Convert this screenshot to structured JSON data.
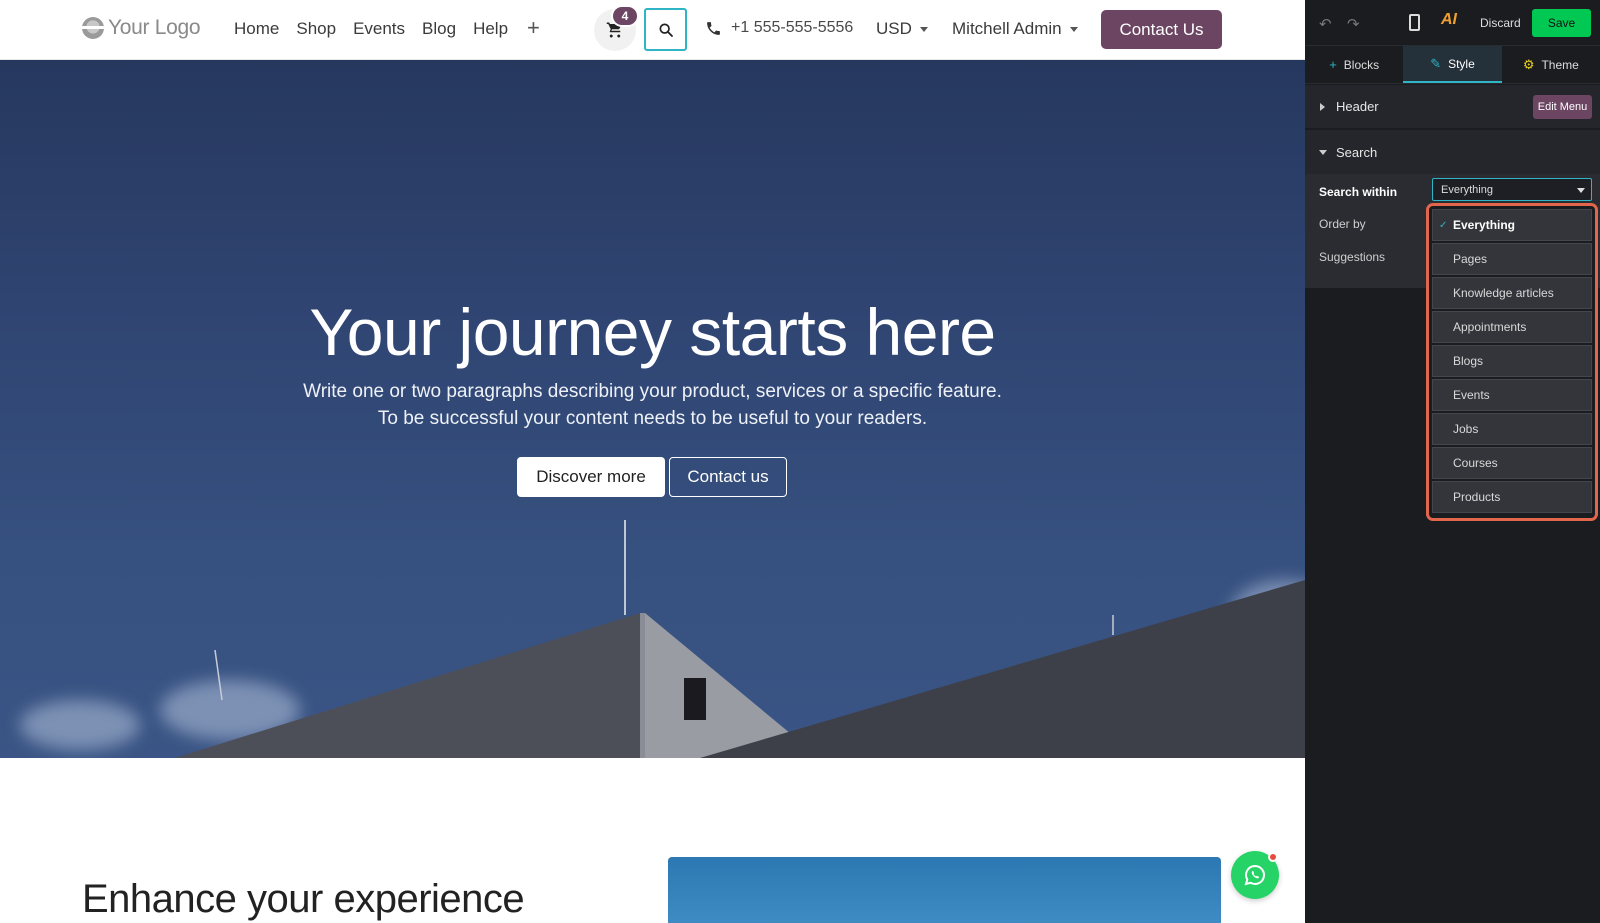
{
  "site": {
    "logo_text": "Your Logo",
    "menu": [
      "Home",
      "Shop",
      "Events",
      "Blog",
      "Help"
    ],
    "add_menu_symbol": "+",
    "cart_count": "4",
    "phone": "+1 555-555-5556",
    "currency": "USD",
    "user": "Mitchell Admin",
    "contact_button": "Contact Us"
  },
  "hero": {
    "title": "Your journey starts here",
    "paragraph_line1": "Write one or two paragraphs describing your product, services or a specific feature.",
    "paragraph_line2": "To be successful your content needs to be useful to your readers.",
    "primary_button": "Discover more",
    "secondary_button": "Contact us"
  },
  "section2": {
    "title": "Enhance your experience"
  },
  "editor": {
    "discard_label": "Discard",
    "save_label": "Save",
    "tabs": [
      {
        "label": "Blocks",
        "icon": "plus-icon"
      },
      {
        "label": "Style",
        "icon": "pencil-icon",
        "active": true
      },
      {
        "label": "Theme",
        "icon": "gear-icon"
      }
    ],
    "sections": {
      "header_title": "Header",
      "edit_menu_label": "Edit Menu",
      "search_title": "Search"
    },
    "options": {
      "search_within_label": "Search within",
      "search_within_value": "Everything",
      "order_by_label": "Order by",
      "suggestions_label": "Suggestions"
    },
    "dropdown_items": [
      {
        "label": "Everything",
        "checked": true
      },
      {
        "label": "Pages"
      },
      {
        "label": "Knowledge articles"
      },
      {
        "label": "Appointments"
      },
      {
        "label": "Blogs"
      },
      {
        "label": "Events"
      },
      {
        "label": "Jobs"
      },
      {
        "label": "Courses"
      },
      {
        "label": "Products"
      }
    ]
  },
  "colors": {
    "brand": "#6b4562",
    "accent": "#2fb5c5",
    "save": "#00c853",
    "highlight": "#e2664c",
    "whatsapp": "#25d366"
  }
}
